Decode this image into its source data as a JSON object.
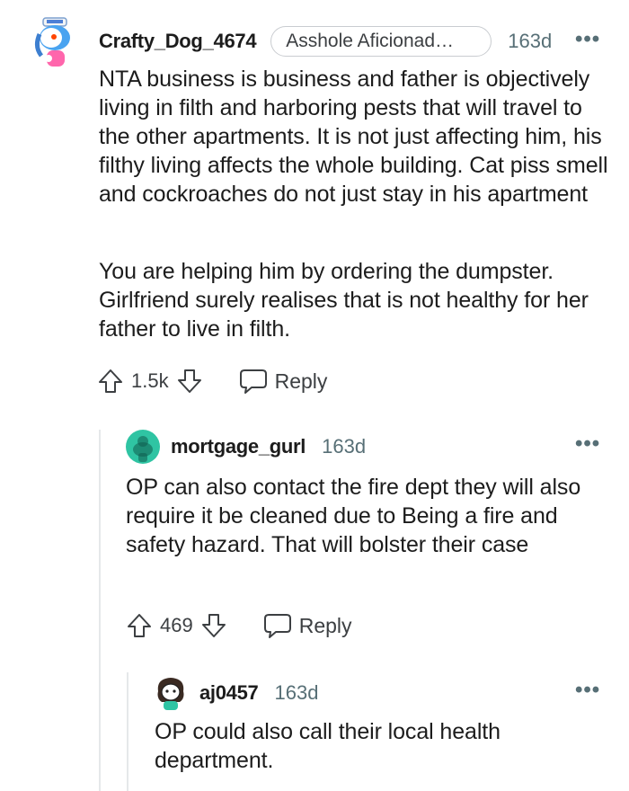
{
  "comments": [
    {
      "username": "Crafty_Dog_4674",
      "flair": "Asshole Aficionad…",
      "age": "163d",
      "more": "•••",
      "paragraphs": [
        "NTA business is business and father is objectively living in filth and harboring pests that will travel to the other apartments. It is not just affecting him, his filthy living affects the whole building. Cat piss smell and cockroaches do not just stay in his apartment",
        "You are helping him by ordering the dumpster. Girlfriend surely realises that is not healthy for her father to live in filth."
      ],
      "score": "1.5k",
      "reply_label": "Reply"
    },
    {
      "username": "mortgage_gurl",
      "age": "163d",
      "more": "•••",
      "paragraphs": [
        "OP can also contact the fire dept they will also require it be cleaned due to Being a fire and safety hazard. That will bolster their case"
      ],
      "score": "469",
      "reply_label": "Reply"
    },
    {
      "username": "aj0457",
      "age": "163d",
      "more": "•••",
      "paragraphs": [
        "OP could also call their local health department."
      ]
    }
  ],
  "colors": {
    "text": "#1c1c1c",
    "meta": "#576f76",
    "thread_line": "#e5e8ea",
    "avatar_teal": "#2fc4a3"
  }
}
